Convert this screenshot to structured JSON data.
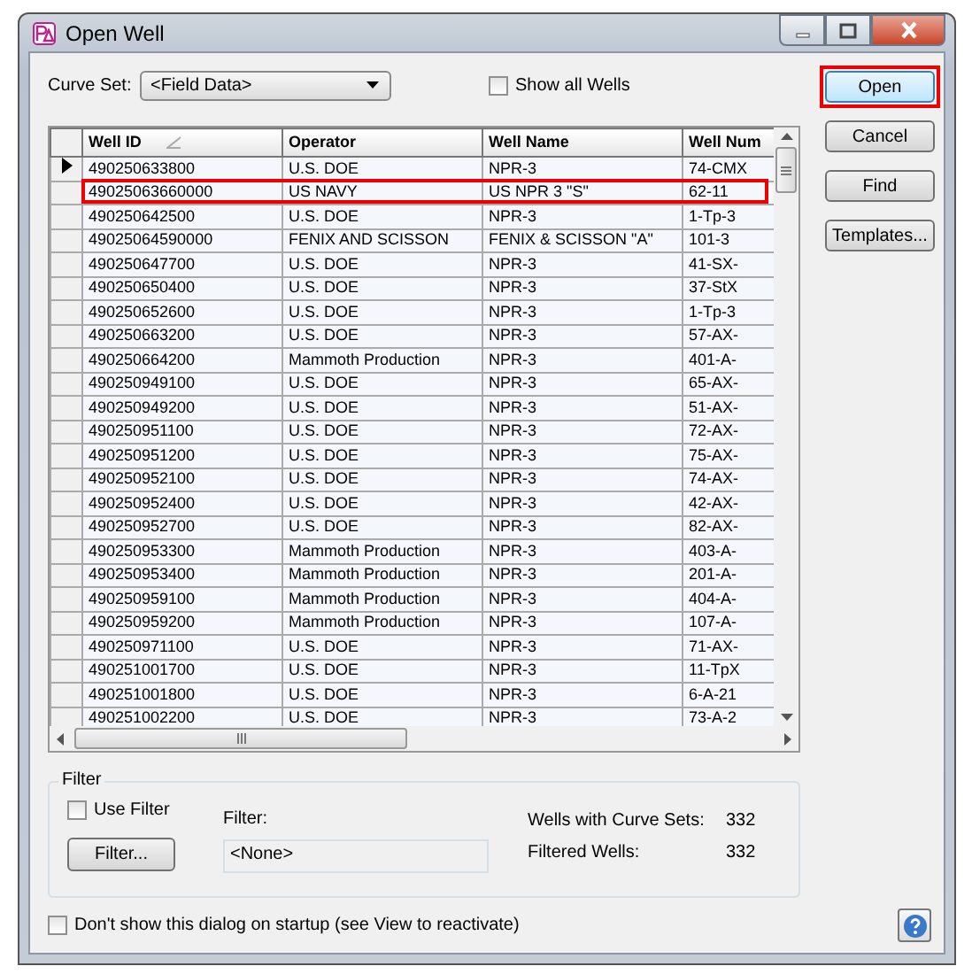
{
  "window": {
    "title": "Open Well"
  },
  "curve_set": {
    "label": "Curve Set:",
    "value": "<Field Data>"
  },
  "show_all_wells": {
    "label": "Show all Wells",
    "checked": false
  },
  "buttons": [
    {
      "label": "Open",
      "highlighted": true
    },
    {
      "label": "Cancel",
      "highlighted": false
    },
    {
      "label": "Find",
      "highlighted": false
    },
    {
      "label": "Templates...",
      "highlighted": false
    }
  ],
  "table": {
    "columns": [
      {
        "label": "Well ID",
        "sorted": true
      },
      {
        "label": "Operator",
        "sorted": false
      },
      {
        "label": "Well Name",
        "sorted": false
      },
      {
        "label": "Well Num",
        "sorted": false
      }
    ],
    "rows": [
      {
        "cells": [
          "490250633800",
          "U.S. DOE",
          "NPR-3",
          "74-CMX"
        ],
        "current": true,
        "highlighted": false
      },
      {
        "cells": [
          "49025063660000",
          "US NAVY",
          "US NPR 3 \"S\"",
          "62-11"
        ],
        "current": false,
        "highlighted": true
      },
      {
        "cells": [
          "490250642500",
          "U.S. DOE",
          "NPR-3",
          "1-Tp-3"
        ],
        "current": false,
        "highlighted": false
      },
      {
        "cells": [
          "49025064590000",
          "FENIX AND SCISSON",
          "FENIX & SCISSON \"A\"",
          "101-3"
        ],
        "current": false,
        "highlighted": false
      },
      {
        "cells": [
          "490250647700",
          "U.S. DOE",
          "NPR-3",
          "41-SX-"
        ],
        "current": false,
        "highlighted": false
      },
      {
        "cells": [
          "490250650400",
          "U.S. DOE",
          "NPR-3",
          "37-StX"
        ],
        "current": false,
        "highlighted": false
      },
      {
        "cells": [
          "490250652600",
          "U.S. DOE",
          "NPR-3",
          "1-Tp-3"
        ],
        "current": false,
        "highlighted": false
      },
      {
        "cells": [
          "490250663200",
          "U.S. DOE",
          "NPR-3",
          "57-AX-"
        ],
        "current": false,
        "highlighted": false
      },
      {
        "cells": [
          "490250664200",
          "Mammoth Production",
          "NPR-3",
          "401-A-"
        ],
        "current": false,
        "highlighted": false
      },
      {
        "cells": [
          "490250949100",
          "U.S. DOE",
          "NPR-3",
          "65-AX-"
        ],
        "current": false,
        "highlighted": false
      },
      {
        "cells": [
          "490250949200",
          "U.S. DOE",
          "NPR-3",
          "51-AX-"
        ],
        "current": false,
        "highlighted": false
      },
      {
        "cells": [
          "490250951100",
          "U.S. DOE",
          "NPR-3",
          "72-AX-"
        ],
        "current": false,
        "highlighted": false
      },
      {
        "cells": [
          "490250951200",
          "U.S. DOE",
          "NPR-3",
          "75-AX-"
        ],
        "current": false,
        "highlighted": false
      },
      {
        "cells": [
          "490250952100",
          "U.S. DOE",
          "NPR-3",
          "74-AX-"
        ],
        "current": false,
        "highlighted": false
      },
      {
        "cells": [
          "490250952400",
          "U.S. DOE",
          "NPR-3",
          "42-AX-"
        ],
        "current": false,
        "highlighted": false
      },
      {
        "cells": [
          "490250952700",
          "U.S. DOE",
          "NPR-3",
          "82-AX-"
        ],
        "current": false,
        "highlighted": false
      },
      {
        "cells": [
          "490250953300",
          "Mammoth Production",
          "NPR-3",
          "403-A-"
        ],
        "current": false,
        "highlighted": false
      },
      {
        "cells": [
          "490250953400",
          "Mammoth Production",
          "NPR-3",
          "201-A-"
        ],
        "current": false,
        "highlighted": false
      },
      {
        "cells": [
          "490250959100",
          "Mammoth Production",
          "NPR-3",
          "404-A-"
        ],
        "current": false,
        "highlighted": false
      },
      {
        "cells": [
          "490250959200",
          "Mammoth Production",
          "NPR-3",
          "107-A-"
        ],
        "current": false,
        "highlighted": false
      },
      {
        "cells": [
          "490250971100",
          "U.S. DOE",
          "NPR-3",
          "71-AX-"
        ],
        "current": false,
        "highlighted": false
      },
      {
        "cells": [
          "490251001700",
          "U.S. DOE",
          "NPR-3",
          "11-TpX"
        ],
        "current": false,
        "highlighted": false
      },
      {
        "cells": [
          "490251001800",
          "U.S. DOE",
          "NPR-3",
          "6-A-21"
        ],
        "current": false,
        "highlighted": false
      },
      {
        "cells": [
          "490251002200",
          "U.S. DOE",
          "NPR-3",
          "73-A-2"
        ],
        "current": false,
        "highlighted": false
      }
    ]
  },
  "filter": {
    "title": "Filter",
    "use_filter": {
      "label": "Use Filter",
      "checked": false
    },
    "button": "Filter...",
    "filter_label": "Filter:",
    "filter_value": "<None>",
    "stats": [
      {
        "label": "Wells with Curve Sets:",
        "value": "332"
      },
      {
        "label": "Filtered Wells:",
        "value": "332"
      }
    ]
  },
  "startup": {
    "label": "Don't show this dialog on startup (see View to reactivate)",
    "checked": false
  }
}
